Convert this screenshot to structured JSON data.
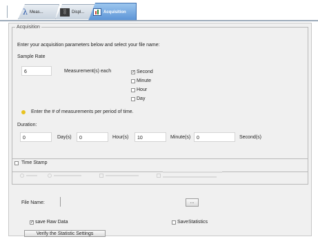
{
  "tabs": [
    {
      "label": "Meas...",
      "icon": "lambda-icon"
    },
    {
      "label": "Displ...",
      "icon": "display-icon"
    },
    {
      "label": "Acquisition",
      "icon": "acquisition-icon"
    }
  ],
  "acquisition": {
    "legend": "Acquisition",
    "instructions": "Enter your acquisition parameters below and select your file name:",
    "sample_rate_label": "Sample Rate",
    "sample_rate_value": "6",
    "measurements_each_label": "Measurement(s) each",
    "units": [
      {
        "label": "Second",
        "checked": true
      },
      {
        "label": "Minute",
        "checked": false
      },
      {
        "label": "Hour",
        "checked": false
      },
      {
        "label": "Day",
        "checked": false
      }
    ],
    "hint": "Enter the # of measurements per period of time.",
    "duration_label": "Duration:",
    "duration": [
      {
        "value": "0",
        "unit": "Day(s)"
      },
      {
        "value": "0",
        "unit": "Hour(s)"
      },
      {
        "value": "10",
        "unit": "Minute(s)"
      },
      {
        "value": "0",
        "unit": "Second(s)"
      }
    ]
  },
  "timestamp": {
    "label": "Time Stamp",
    "checked": false
  },
  "file": {
    "label": "File Name:",
    "value": "",
    "browse_label": "..."
  },
  "options": {
    "save_raw_label": "save Raw Data",
    "save_raw_checked": true,
    "save_stats_label": "SaveStatistics",
    "save_stats_checked": false
  },
  "verify_button_label": "Verify the Statistic Settings",
  "colors": {
    "active_tab": "#5a93d6",
    "panel_bg": "#f0f0f0",
    "info_icon": "#e8c21f"
  }
}
